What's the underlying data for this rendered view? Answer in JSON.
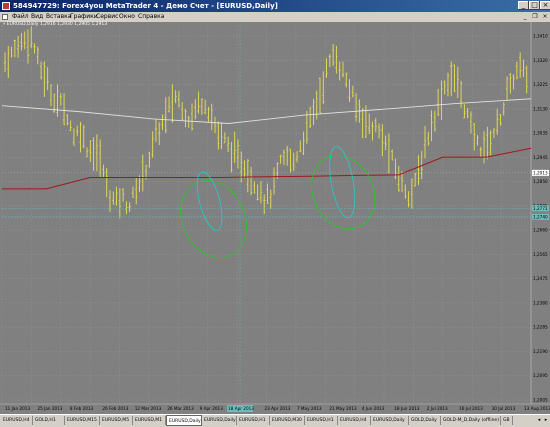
{
  "window": {
    "title": "584947729: Forex4you MetaTrader 4 - Демо Счет - [EURUSD,Daily]",
    "minimize": "_",
    "maximize": "□",
    "close": "×"
  },
  "menu": {
    "items": [
      "Файл",
      "Вид",
      "Вставка",
      "Графики",
      "Сервис",
      "Окно",
      "Справка"
    ],
    "minimize": "_",
    "restore": "❐",
    "close": "×"
  },
  "chart": {
    "header": "EURUSD,Daily  1,2916 1,2930 1,2905 1,2913",
    "colors": {
      "background": "#808080",
      "bars": "#e8e050",
      "grid": "#9a9a9a",
      "ma_white": "#e0e0e0",
      "ma_red": "#a01818",
      "green_ellipse": "#22cc22",
      "cyan_ellipse": "#22cccc",
      "level_line": "#55cccc",
      "price_label_bg": "#6fbcbc"
    },
    "price_axis_labels": [
      "1,3410",
      "1,3320",
      "1,3225",
      "1,3130",
      "1,3035",
      "1,2945",
      "1,2850",
      "1,2805",
      "1,2660",
      "1,2565",
      "1,2475",
      "1,2380",
      "1,2285",
      "1,2190",
      "1,2095",
      "1,2005"
    ],
    "highlighted_prices": [
      "1,2913",
      "1,2771",
      "1,2740"
    ],
    "time_axis_labels": [
      "11 Jan 2013",
      "25 Jan 2013",
      "8 Feb 2013",
      "26 Feb 2013",
      "12 Mar 2013",
      "26 Mar 2013",
      "9 Apr 2013",
      "",
      "23 Apr 2013",
      "7 May 2013",
      "21 May 2013",
      "4 Jun 2013",
      "18 Jun 2013",
      "2 Jul 2013",
      "16 Jul 2013",
      "30 Jul 2013",
      "13 Aug 2013"
    ],
    "highlighted_date": "18 Apr 2013"
  },
  "chart_data": {
    "type": "candlestick-bars",
    "symbol": "EURUSD",
    "timeframe": "Daily",
    "ylim": [
      1.2005,
      1.349
    ],
    "bars_count": 160,
    "ohlc_last": {
      "open": 1.2916,
      "high": 1.293,
      "low": 1.2905,
      "close": 1.2913
    },
    "series": [
      {
        "style": "white-line",
        "values": [
          1.3177,
          1.3154,
          1.3125,
          1.3107,
          1.314,
          1.3162,
          1.3185,
          1.3204
        ]
      },
      {
        "style": "red-line",
        "values": [
          1.285,
          1.285,
          1.2895,
          1.2895,
          1.2895,
          1.2895,
          1.2898,
          1.29,
          1.2903,
          1.2905,
          1.2975,
          1.2975,
          1.301
        ]
      }
    ],
    "horizontal_levels": [
      1.2774,
      1.274
    ],
    "price_path": [
      1.335,
      1.338,
      1.342,
      1.344,
      1.344,
      1.333,
      1.328,
      1.321,
      1.319,
      1.315,
      1.306,
      1.308,
      1.301,
      1.3,
      1.296,
      1.284,
      1.28,
      1.282,
      1.278,
      1.284,
      1.29,
      1.297,
      1.306,
      1.311,
      1.317,
      1.322,
      1.316,
      1.312,
      1.318,
      1.32,
      1.314,
      1.307,
      1.304,
      1.3,
      1.296,
      1.294,
      1.288,
      1.286,
      1.28,
      1.284,
      1.294,
      1.298,
      1.295,
      1.302,
      1.308,
      1.316,
      1.323,
      1.333,
      1.338,
      1.332,
      1.326,
      1.318,
      1.314,
      1.31,
      1.309,
      1.305,
      1.299,
      1.292,
      1.286,
      1.283,
      1.288,
      1.3,
      1.309,
      1.317,
      1.325,
      1.329,
      1.326,
      1.317,
      1.308,
      1.302,
      1.301,
      1.306,
      1.312,
      1.321,
      1.328,
      1.333,
      1.328
    ]
  },
  "tabs": [
    "EURUSD,H4",
    "GOLD,H1",
    "EURUSD,M15",
    "EURUSD,M5",
    "EURUSD,M1",
    "EURUSD,Daily",
    "EURUSD,Daily",
    "EURUSD,H1",
    "EURUSD,M30",
    "EURUSD,H1",
    "EURUSD,H4",
    "EURUSD,Daily",
    "GOLD,Daily",
    "GOLD-M_D,Daily (offline)",
    "GB"
  ],
  "active_tab_index": 5
}
